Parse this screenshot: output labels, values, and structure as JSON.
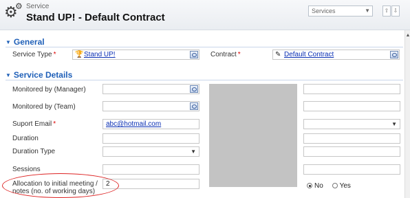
{
  "header": {
    "entity_type": "Service",
    "title": "Stand UP! - Default Contract",
    "form_selector": "Services"
  },
  "sections": {
    "general": "General",
    "details": "Service Details"
  },
  "general": {
    "service_type_label": "Service Type",
    "service_type_value": "Stand UP!",
    "contract_label": "Contract",
    "contract_value": "Default Contract"
  },
  "details": {
    "monitored_manager_label": "Monitored by (Manager)",
    "monitored_team_label": "Monitored by (Team)",
    "support_email_label": "Suport Email",
    "support_email_value": "abc@hotmail.com",
    "duration_label": "Duration",
    "duration_type_label": "Duration Type",
    "sessions_label": "Sessions",
    "allocation_label_line1": "Allocation to initial meeting /",
    "allocation_label_line2": "notes (no. of working days)",
    "allocation_value": "2"
  },
  "radio": {
    "no_label": "No",
    "yes_label": "Yes",
    "selected": "No"
  },
  "required_mark": "*",
  "colors": {
    "section_title": "#1e5fb8",
    "annotation": "#d22222",
    "link": "#0a2fb4"
  }
}
